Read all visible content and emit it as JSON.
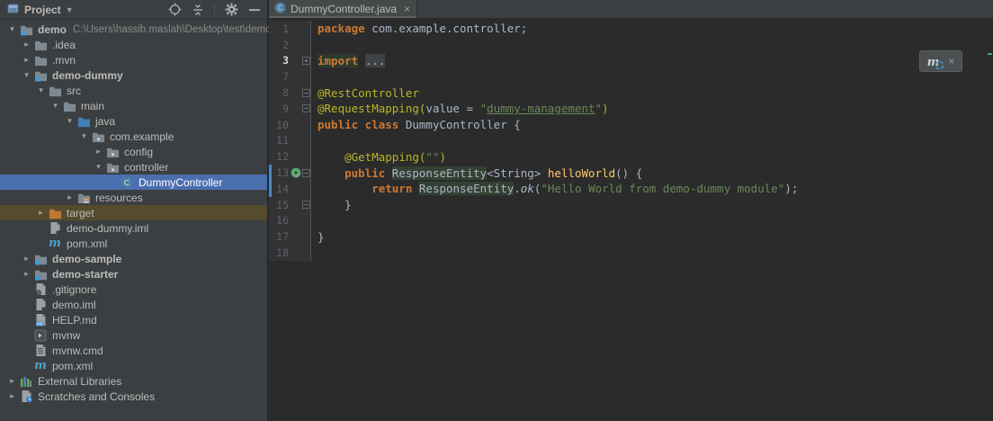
{
  "panel": {
    "title": "Project",
    "header_icons": [
      {
        "name": "locate-icon"
      },
      {
        "name": "collapse-all-icon"
      },
      {
        "name": "separator"
      },
      {
        "name": "settings-gear-icon"
      },
      {
        "name": "hide-panel-icon"
      }
    ],
    "tree": [
      {
        "label": "demo",
        "hint": "C:\\Users\\hassib.maslah\\Desktop\\test\\demo",
        "depth": 0,
        "chevron": "expanded",
        "icon": "folder-module",
        "bold": true
      },
      {
        "label": ".idea",
        "depth": 1,
        "chevron": "collapsed",
        "icon": "folder"
      },
      {
        "label": ".mvn",
        "depth": 1,
        "chevron": "collapsed",
        "icon": "folder"
      },
      {
        "label": "demo-dummy",
        "depth": 1,
        "chevron": "expanded",
        "icon": "folder-module",
        "bold": true
      },
      {
        "label": "src",
        "depth": 2,
        "chevron": "expanded",
        "icon": "folder"
      },
      {
        "label": "main",
        "depth": 3,
        "chevron": "expanded",
        "icon": "folder"
      },
      {
        "label": "java",
        "depth": 4,
        "chevron": "expanded",
        "icon": "folder-source"
      },
      {
        "label": "com.example",
        "depth": 5,
        "chevron": "expanded",
        "icon": "package"
      },
      {
        "label": "config",
        "depth": 6,
        "chevron": "collapsed",
        "icon": "package"
      },
      {
        "label": "controller",
        "depth": 6,
        "chevron": "expanded",
        "icon": "package"
      },
      {
        "label": "DummyController",
        "depth": 7,
        "chevron": "none",
        "icon": "class",
        "selected": true
      },
      {
        "label": "resources",
        "depth": 4,
        "chevron": "collapsed",
        "icon": "folder-resources"
      },
      {
        "label": "target",
        "depth": 2,
        "chevron": "collapsed",
        "icon": "folder-excluded",
        "excluded": true
      },
      {
        "label": "demo-dummy.iml",
        "depth": 2,
        "chevron": "none",
        "icon": "file-iml"
      },
      {
        "label": "pom.xml",
        "depth": 2,
        "chevron": "none",
        "icon": "maven"
      },
      {
        "label": "demo-sample",
        "depth": 1,
        "chevron": "collapsed",
        "icon": "folder-module",
        "bold": true
      },
      {
        "label": "demo-starter",
        "depth": 1,
        "chevron": "collapsed",
        "icon": "folder-module",
        "bold": true
      },
      {
        "label": ".gitignore",
        "depth": 1,
        "chevron": "none",
        "icon": "file-git"
      },
      {
        "label": "demo.iml",
        "depth": 1,
        "chevron": "none",
        "icon": "file-iml"
      },
      {
        "label": "HELP.md",
        "depth": 1,
        "chevron": "none",
        "icon": "file-md"
      },
      {
        "label": "mvnw",
        "depth": 1,
        "chevron": "none",
        "icon": "file-run"
      },
      {
        "label": "mvnw.cmd",
        "depth": 1,
        "chevron": "none",
        "icon": "file-cmd"
      },
      {
        "label": "pom.xml",
        "depth": 1,
        "chevron": "none",
        "icon": "maven"
      },
      {
        "label": "External Libraries",
        "depth": 0,
        "chevron": "collapsed",
        "icon": "ext-lib"
      },
      {
        "label": "Scratches and Consoles",
        "depth": 0,
        "chevron": "collapsed",
        "icon": "scratches"
      }
    ]
  },
  "editor": {
    "tab": {
      "title": "DummyController.java",
      "icon": "class-icon",
      "close": "×"
    },
    "maven_popup": {
      "icon": "maven-reload-icon",
      "close": "×"
    },
    "code": [
      {
        "num": "1",
        "segments": [
          [
            "kw",
            "package"
          ],
          [
            "def",
            " com.example.controller;"
          ]
        ]
      },
      {
        "num": "2",
        "segments": []
      },
      {
        "num": "3",
        "caret": true,
        "fold": "plus",
        "segments": [
          [
            "fold-kw",
            "import"
          ],
          [
            "def",
            " "
          ],
          [
            "fold-dots",
            "..."
          ]
        ]
      },
      {
        "num": "7",
        "segments": []
      },
      {
        "num": "8",
        "fold": "minus",
        "segments": [
          [
            "ann",
            "@RestController"
          ]
        ]
      },
      {
        "num": "9",
        "fold": "minus",
        "segments": [
          [
            "ann",
            "@RequestMapping("
          ],
          [
            "def",
            "value = "
          ],
          [
            "str",
            "\""
          ],
          [
            "str-u",
            "dummy-management"
          ],
          [
            "str",
            "\""
          ],
          [
            "ann",
            ")"
          ]
        ]
      },
      {
        "num": "10",
        "segments": [
          [
            "kw",
            "public class"
          ],
          [
            "def",
            " DummyController {"
          ]
        ]
      },
      {
        "num": "11",
        "segments": []
      },
      {
        "num": "12",
        "segments": [
          [
            "def",
            "    "
          ],
          [
            "ann",
            "@GetMapping("
          ],
          [
            "str",
            "\"\""
          ],
          [
            "ann",
            ")"
          ]
        ]
      },
      {
        "num": "13",
        "icon": "spring-mapping",
        "fold": "minus",
        "vcs": true,
        "segments": [
          [
            "def",
            "    "
          ],
          [
            "kw",
            "public"
          ],
          [
            "def",
            " "
          ],
          [
            "hl",
            "ResponseEntity"
          ],
          [
            "def",
            "<String> "
          ],
          [
            "mth",
            "helloWorld"
          ],
          [
            "def",
            "() {"
          ]
        ]
      },
      {
        "num": "14",
        "vcs": true,
        "segments": [
          [
            "def",
            "        "
          ],
          [
            "kw",
            "return"
          ],
          [
            "def",
            " "
          ],
          [
            "hl",
            "ResponseEntity"
          ],
          [
            "def",
            "."
          ],
          [
            "ital",
            "ok"
          ],
          [
            "def",
            "("
          ],
          [
            "str",
            "\"Hello World from demo-dummy module\""
          ],
          [
            "def",
            ");"
          ]
        ]
      },
      {
        "num": "15",
        "fold": "end",
        "segments": [
          [
            "def",
            "    }"
          ]
        ]
      },
      {
        "num": "16",
        "segments": []
      },
      {
        "num": "17",
        "segments": [
          [
            "def",
            "}"
          ]
        ]
      },
      {
        "num": "18",
        "segments": []
      }
    ]
  },
  "colors": {
    "selection": "#4b6eaf",
    "excluded_row": "#564b2d",
    "keyword": "#cc7832",
    "annotation": "#bbb529",
    "string": "#6a8759",
    "method": "#ffc66d",
    "editor_bg": "#2b2b2b",
    "panel_bg": "#3c3f41"
  }
}
